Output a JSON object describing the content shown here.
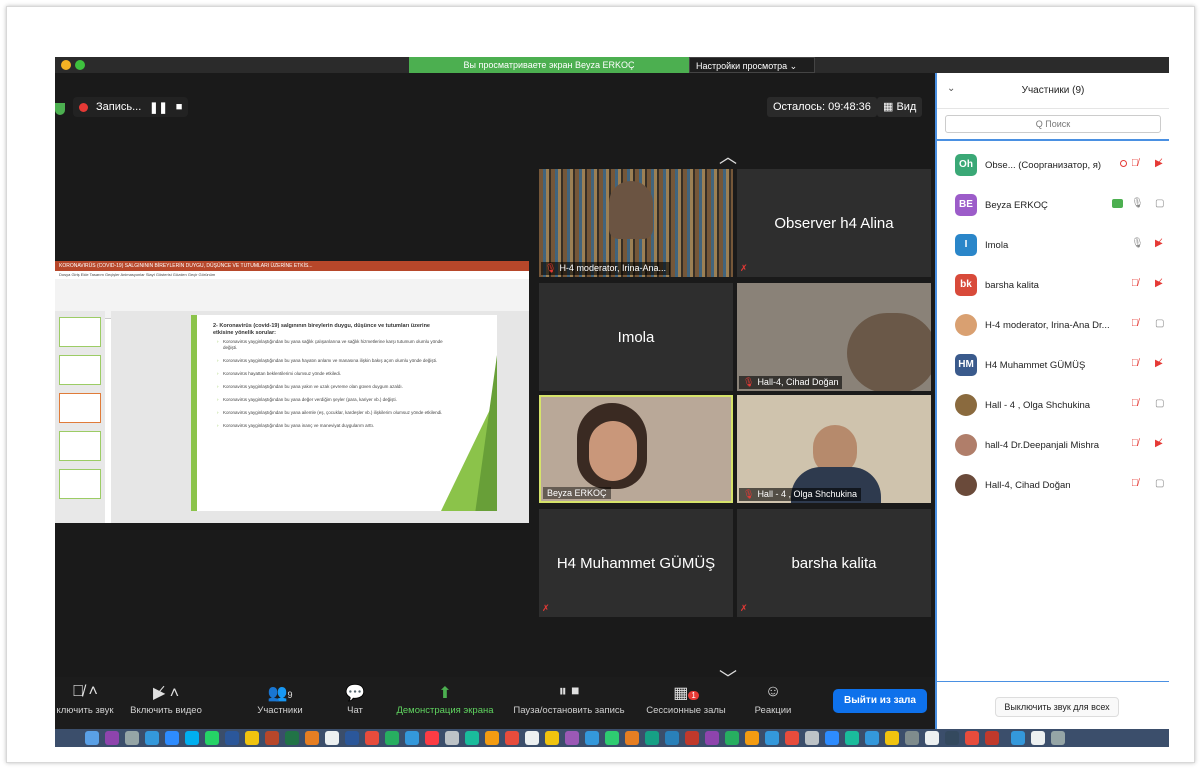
{
  "banner": {
    "sharing_text": "Вы просматриваете экран Beyza ERKOÇ",
    "settings_label": "Настройки просмотра ⌄"
  },
  "recording": {
    "label": "Запись...",
    "pause_icon": "pause-icon",
    "stop_icon": "stop-icon"
  },
  "header": {
    "time_left": "Осталось: 09:48:36",
    "view_label": "Вид"
  },
  "slide": {
    "app_title": "KORONAVIRÜS (COVID-19) SALGINININ BİREYLERİN DUYGU, DÜŞÜNCE VE TUTUMLARI ÜZERİNE ETKİS...",
    "tabs": "Dosya   Giriş   Ekle   Tasarım   Geçişler   Animasyonlar   Slayt Gösterisi   Gözden Geçir   Görünüm",
    "heading": "2- Koronavirüs (covid-19) salgınının bireylerin duygu, düşünce ve tutumları üzerine etkisine yönelik sorular:",
    "items": [
      "Koronavirüs yayginlaştığından bu yana sağlık çalışanlarına ve sağlık hizmetlerine karşı tutumum olumlu yönde değişti.",
      "Koronavirüs yayginlaştığından bu yana hayatın anlamı ve manasına ilişkin bakış açım olumlu yönde değişti.",
      "Koronavirüs hayattan beklentilerimi olumsuz yönde etkiledi.",
      "Koronavirüs yayginlaştığından bu yana yakın ve uzak çevreme olan güven duygum azaldı.",
      "Koronavirüs yayginlaştığından bu yana değer verdiğim şeyler (para, kariyer vb.) değişti.",
      "Koronavirüs yayginlaştığından bu yana ailemle (eş, çocuklar, kardeşler vb.) ilişkilerim olumsuz yönde etkilendi.",
      "Koronavirüs yayginlaştığından bu yana inanç ve maneviyat duygularım arttı."
    ]
  },
  "tiles": [
    {
      "label": "H-4 moderator, Irina-Ana...",
      "kind": "video"
    },
    {
      "name": "Observer h4 Alina",
      "kind": "name"
    },
    {
      "name": "Imola",
      "kind": "name"
    },
    {
      "label": "Hall-4, Cihad Doğan",
      "kind": "video"
    },
    {
      "label": "Beyza ERKOÇ",
      "kind": "video"
    },
    {
      "label": "Hall - 4 ,  Olga Shchukina",
      "kind": "video"
    },
    {
      "name": "H4 Muhammet GÜMÜŞ",
      "kind": "name"
    },
    {
      "name": "barsha kalita",
      "kind": "name"
    }
  ],
  "toolbar": {
    "unmute": "ключить звук",
    "start_video": "Включить видео",
    "participants": "Участники",
    "participants_count": "9",
    "chat": "Чат",
    "share": "Демонстрация экрана",
    "pause_rec": "Пауза/остановить запись",
    "breakout": "Сессионные залы",
    "breakout_badge": "1",
    "reactions": "Реакции",
    "leave": "Выйти из зала"
  },
  "panel": {
    "title": "Участники (9)",
    "search_placeholder": "Q  Поиск",
    "mute_all": "Выключить звук для всех",
    "participants": [
      {
        "initials": "Oh",
        "name": "Obse...  (Соорганизатор, я)",
        "color": "#3aa876",
        "mic": "muted",
        "video": "off"
      },
      {
        "initials": "BE",
        "name": "Beyza ERKOÇ",
        "color": "#9c5cc9",
        "mic": "on",
        "video": "on"
      },
      {
        "initials": "I",
        "name": "Imola",
        "color": "#2a86c9",
        "mic": "on",
        "video": "off"
      },
      {
        "initials": "bk",
        "name": "barsha kalita",
        "color": "#d84a3a",
        "mic": "muted",
        "video": "off"
      },
      {
        "initials": "",
        "name": "H-4 moderator, Irina-Ana Dr...",
        "color": "#d9a071",
        "mic": "muted",
        "video": "on"
      },
      {
        "initials": "HM",
        "name": "H4 Muhammet GÜMÜŞ",
        "color": "#3a5a8c",
        "mic": "muted",
        "video": "off"
      },
      {
        "initials": "",
        "name": "Hall - 4 ,  Olga Shchukina",
        "color": "#8a6a3e",
        "mic": "muted",
        "video": "on"
      },
      {
        "initials": "",
        "name": "hall-4 Dr.Deepanjali Mishra",
        "color": "#b07e6a",
        "mic": "muted",
        "video": "off"
      },
      {
        "initials": "",
        "name": "Hall-4, Cihad Doğan",
        "color": "#6a4a3a",
        "mic": "muted",
        "video": "on"
      }
    ]
  }
}
